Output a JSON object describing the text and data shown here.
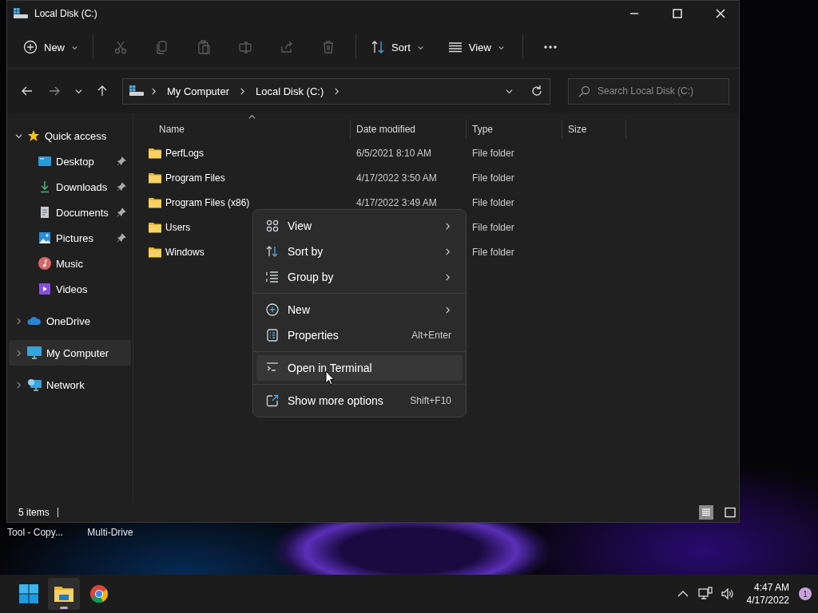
{
  "window": {
    "title": "Local Disk (C:)"
  },
  "command_bar": {
    "new_button": "New",
    "edit_actions": [
      {
        "disabled": true
      },
      {
        "disabled": true
      },
      {
        "disabled": true
      },
      {
        "disabled": true
      },
      {
        "disabled": true
      },
      {
        "disabled": true
      }
    ],
    "sort_button": "Sort",
    "view_button": "View"
  },
  "navigation": {
    "back_disabled": false,
    "forward_disabled": true
  },
  "address_bar": {
    "crumbs": [
      "My Computer",
      "Local Disk (C:)"
    ]
  },
  "search": {
    "placeholder": "Search Local Disk (C:)"
  },
  "sidebar": {
    "items": [
      {
        "label": "Quick access",
        "expanded": true,
        "selected": false,
        "children": [
          {
            "label": "Desktop",
            "pinned": true,
            "selected": false
          },
          {
            "label": "Downloads",
            "pinned": true,
            "selected": false
          },
          {
            "label": "Documents",
            "pinned": true,
            "selected": false
          },
          {
            "label": "Pictures",
            "pinned": true,
            "selected": false
          },
          {
            "label": "Music",
            "pinned": false,
            "selected": false
          },
          {
            "label": "Videos",
            "pinned": false,
            "selected": false
          }
        ]
      },
      {
        "label": "OneDrive",
        "expanded": false,
        "selected": false
      },
      {
        "label": "My Computer",
        "expanded": false,
        "selected": true
      },
      {
        "label": "Network",
        "expanded": false,
        "selected": false
      }
    ]
  },
  "table": {
    "columns": [
      "Name",
      "Date modified",
      "Type",
      "Size"
    ],
    "rows": [
      {
        "name": "PerfLogs",
        "date_modified": "6/5/2021 8:10 AM",
        "type": "File folder"
      },
      {
        "name": "Program Files",
        "date_modified": "4/17/2022 3:50 AM",
        "type": "File folder"
      },
      {
        "name": "Program Files (x86)",
        "date_modified": "4/17/2022 3:49 AM",
        "type": "File folder"
      },
      {
        "name": "Users",
        "type": "File folder"
      },
      {
        "name": "Windows",
        "type": "File folder"
      }
    ]
  },
  "context_menu": {
    "items": [
      {
        "kind": "item",
        "label": "View",
        "submenu": true,
        "selected": false
      },
      {
        "kind": "item",
        "label": "Sort by",
        "submenu": true,
        "selected": false
      },
      {
        "kind": "item",
        "label": "Group by",
        "submenu": true,
        "selected": false
      },
      {
        "kind": "separator"
      },
      {
        "kind": "item",
        "label": "New",
        "submenu": true,
        "selected": false
      },
      {
        "kind": "item",
        "label": "Properties",
        "shortcut": "Alt+Enter",
        "submenu": false,
        "selected": false
      },
      {
        "kind": "separator"
      },
      {
        "kind": "item",
        "label": "Open in Terminal",
        "submenu": false,
        "selected": true
      },
      {
        "kind": "separator"
      },
      {
        "kind": "item",
        "label": "Show more options",
        "shortcut": "Shift+F10",
        "submenu": false,
        "selected": false
      }
    ]
  },
  "status_bar": {
    "count": "5 items",
    "view_toggles": [
      {
        "selected": true
      },
      {
        "selected": false
      }
    ]
  },
  "desktop_icons": [
    {
      "label": "Tool - Copy..."
    },
    {
      "label": "Multi-Drive"
    }
  ],
  "taskbar": {
    "apps": [
      {
        "active": false
      },
      {
        "active": true
      },
      {
        "active": false
      }
    ],
    "time": "4:47 AM",
    "date": "4/17/2022",
    "notification_count": "1"
  }
}
